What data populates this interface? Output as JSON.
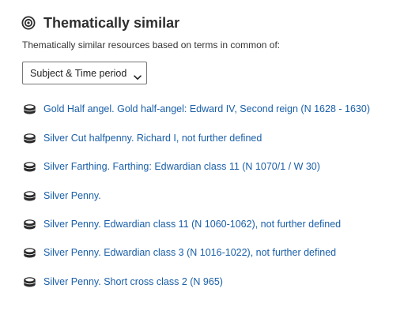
{
  "section": {
    "icon": "target-icon",
    "title": "Thematically similar",
    "subtitle": "Thematically similar resources based on terms in common of:"
  },
  "filter": {
    "selected": "Subject & Time period",
    "icon": "chevron-down-icon"
  },
  "results": {
    "icon": "coin-stack-icon",
    "link_color": "#1a5fa8",
    "items": [
      {
        "label": "Gold Half angel. Gold half-angel: Edward IV, Second reign (N 1628 - 1630)"
      },
      {
        "label": "Silver Cut halfpenny. Richard I, not further defined"
      },
      {
        "label": "Silver Farthing. Farthing: Edwardian class 11 (N 1070/1 / W 30)"
      },
      {
        "label": "Silver Penny."
      },
      {
        "label": "Silver Penny. Edwardian class 11 (N 1060-1062), not further defined"
      },
      {
        "label": "Silver Penny. Edwardian class 3 (N 1016-1022), not further defined"
      },
      {
        "label": "Silver Penny. Short cross class 2 (N 965)"
      }
    ]
  }
}
